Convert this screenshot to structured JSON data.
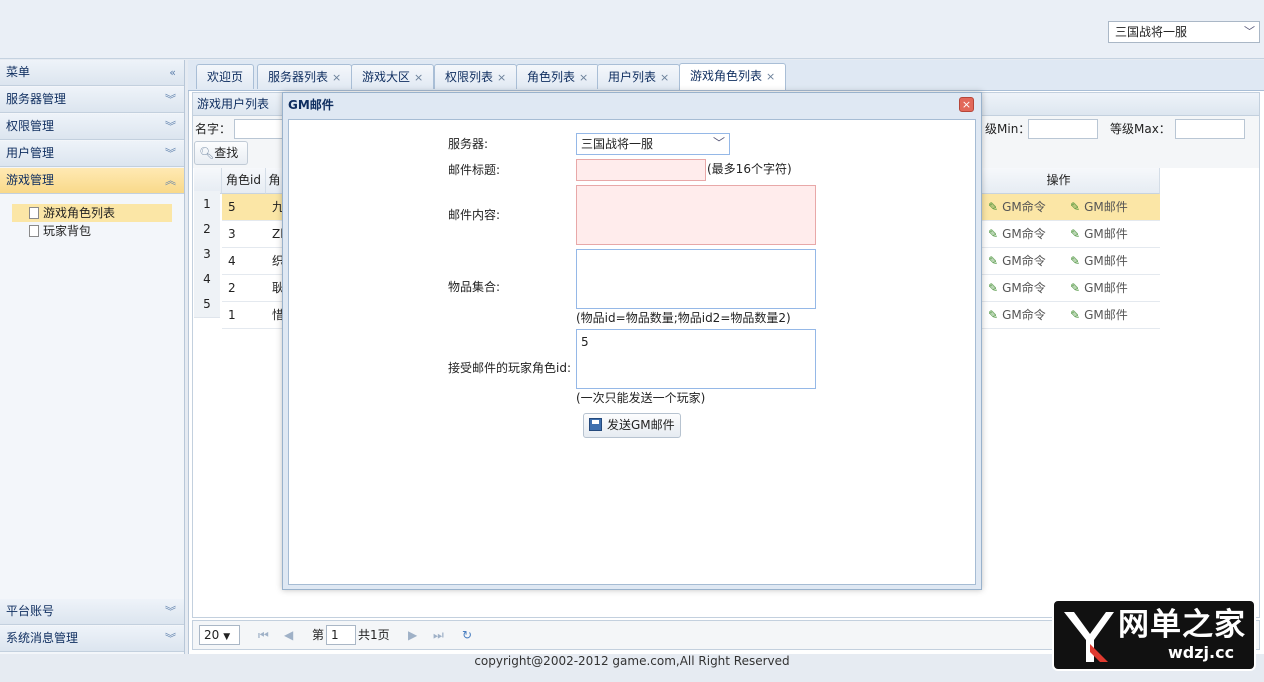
{
  "header": {
    "server_select": "三国战将一服"
  },
  "sidebar": {
    "title": "菜单",
    "sections": [
      {
        "label": "服务器管理"
      },
      {
        "label": "权限管理"
      },
      {
        "label": "用户管理"
      },
      {
        "label": "游戏管理"
      }
    ],
    "tree_items": [
      {
        "label": "游戏角色列表"
      },
      {
        "label": "玩家背包"
      }
    ],
    "bottom_sections": [
      {
        "label": "平台账号"
      },
      {
        "label": "系统消息管理"
      }
    ]
  },
  "tabs": [
    {
      "label": "欢迎页"
    },
    {
      "label": "服务器列表"
    },
    {
      "label": "游戏大区"
    },
    {
      "label": "权限列表"
    },
    {
      "label": "角色列表"
    },
    {
      "label": "用户列表"
    },
    {
      "label": "游戏角色列表"
    }
  ],
  "tab_close": "×",
  "panel": {
    "title": "游戏用户列表",
    "name_label": "名字：",
    "level_min_label": "级Min：",
    "level_max_label": "等级Max：",
    "search_label": "查找"
  },
  "grid": {
    "headers": {
      "role_id": "角色id",
      "name": "角",
      "action": "操作"
    },
    "rows": [
      {
        "num": "1",
        "role_id": "5",
        "name": "九"
      },
      {
        "num": "2",
        "role_id": "3",
        "name": "Zl"
      },
      {
        "num": "3",
        "role_id": "4",
        "name": "织"
      },
      {
        "num": "4",
        "role_id": "2",
        "name": "耿"
      },
      {
        "num": "5",
        "role_id": "1",
        "name": "惜"
      }
    ],
    "action_cmd": "GM命令",
    "action_mail": "GM邮件"
  },
  "pager": {
    "page_size": "20",
    "page_label": "第",
    "page_value": "1",
    "total_label": "共1页"
  },
  "footer": "copyright@2002-2012 game.com,All Right Reserved",
  "modal": {
    "title": "GM邮件",
    "close": "×",
    "server_label": "服务器:",
    "server_value": "三国战将一服",
    "subject_label": "邮件标题:",
    "subject_hint": "(最多16个字符)",
    "content_label": "邮件内容:",
    "items_label": "物品集合:",
    "items_hint": "(物品id=物品数量;物品id2=物品数量2)",
    "receiver_label": "接受邮件的玩家角色id:",
    "receiver_value": "5",
    "receiver_hint": "(一次只能发送一个玩家)",
    "send_label": "发送GM邮件"
  },
  "watermark": {
    "cn": "网单之家",
    "en": "wdzj.cc"
  }
}
